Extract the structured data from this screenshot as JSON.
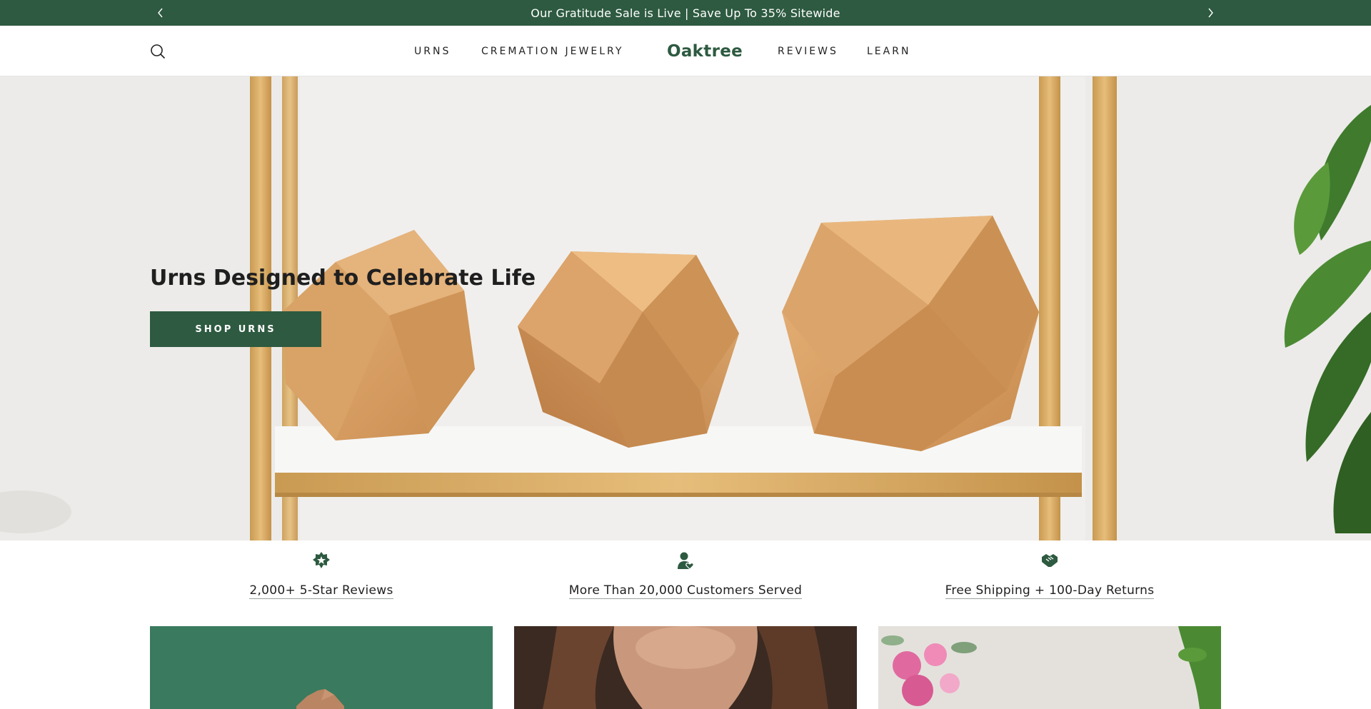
{
  "announcement": {
    "text": "Our Gratitude Sale is Live | Save Up To 35% Sitewide",
    "prev_icon": "chevron-left-icon",
    "next_icon": "chevron-right-icon"
  },
  "header": {
    "search_icon": "search-icon",
    "nav_left": [
      "URNS",
      "CREMATION JEWELRY"
    ],
    "logo": "Oaktree",
    "nav_right": [
      "REVIEWS",
      "LEARN"
    ]
  },
  "hero": {
    "title": "Urns Designed to Celebrate Life",
    "button": "SHOP URNS"
  },
  "features": [
    {
      "icon": "star-badge-icon",
      "label": "2,000+ 5-Star Reviews"
    },
    {
      "icon": "person-heart-icon",
      "label": "More Than 20,000 Customers Served"
    },
    {
      "icon": "handshake-icon",
      "label": "Free Shipping + 100-Day Returns"
    }
  ],
  "colors": {
    "brand_green": "#2d5a40",
    "card_green": "#3a7a5e",
    "text": "#1f1f1f"
  }
}
